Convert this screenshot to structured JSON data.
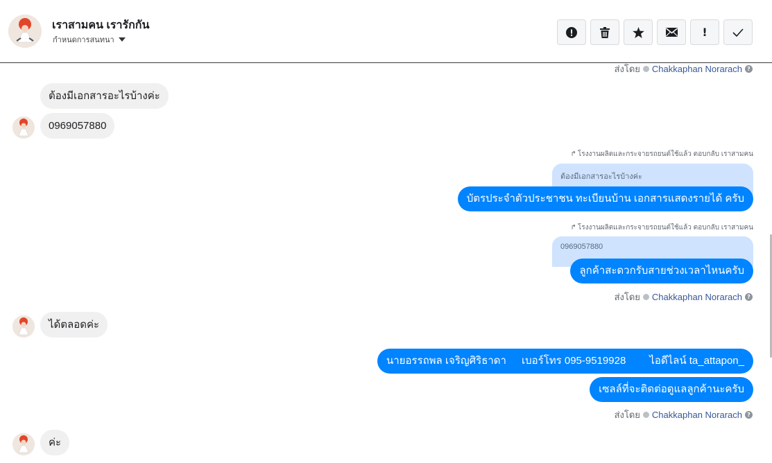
{
  "header": {
    "title": "เราสามคน เรารักกัน",
    "subtitle": "กำหนดการสนทนา"
  },
  "toolbar": {
    "buttons": [
      {
        "name": "report-button",
        "icon": "alert-circle-icon"
      },
      {
        "name": "delete-button",
        "icon": "trash-icon"
      },
      {
        "name": "star-button",
        "icon": "star-icon"
      },
      {
        "name": "mark-unread-button",
        "icon": "envelope-icon"
      },
      {
        "name": "priority-button",
        "icon": "exclamation-icon",
        "glyph": "!"
      },
      {
        "name": "mark-done-button",
        "icon": "check-icon"
      }
    ]
  },
  "sent_by": {
    "prefix": "ส่งโดย",
    "agent": "Chakkaphan Norarach"
  },
  "messages": {
    "in_1": "ต้องมีเอกสารอะไรบ้างค่ะ",
    "in_2": "0969057880",
    "reply_1_meta": "โรงงานผลิตและกระจายรถยนต์ใช้แล้ว ตอบกลับ เราสามคน",
    "reply_1_quote": "ต้องมีเอกสารอะไรบ้างค่ะ",
    "out_1": "บัตรประจำตัวประชาชน ทะเบียนบ้าน เอกสารแสดงรายได้ ครับ",
    "reply_2_meta": "โรงงานผลิตและกระจายรถยนต์ใช้แล้ว ตอบกลับ เราสามคน",
    "reply_2_quote": "0969057880",
    "out_2": "ลูกค้าสะดวกรับสายช่วงเวลาไหนครับ",
    "in_3": "ได้ตลอดค่ะ",
    "out_3_a": "นายอรรถพล เจริญศิริธาดา",
    "out_3_b": "เบอร์โทร 095-9519928",
    "out_3_c": "ไอดีไลน์ ta_attapon_",
    "out_4": "เซลล์ที่จะติดต่อดูแลลูกค้านะครับ",
    "in_4": "ค่ะ"
  }
}
